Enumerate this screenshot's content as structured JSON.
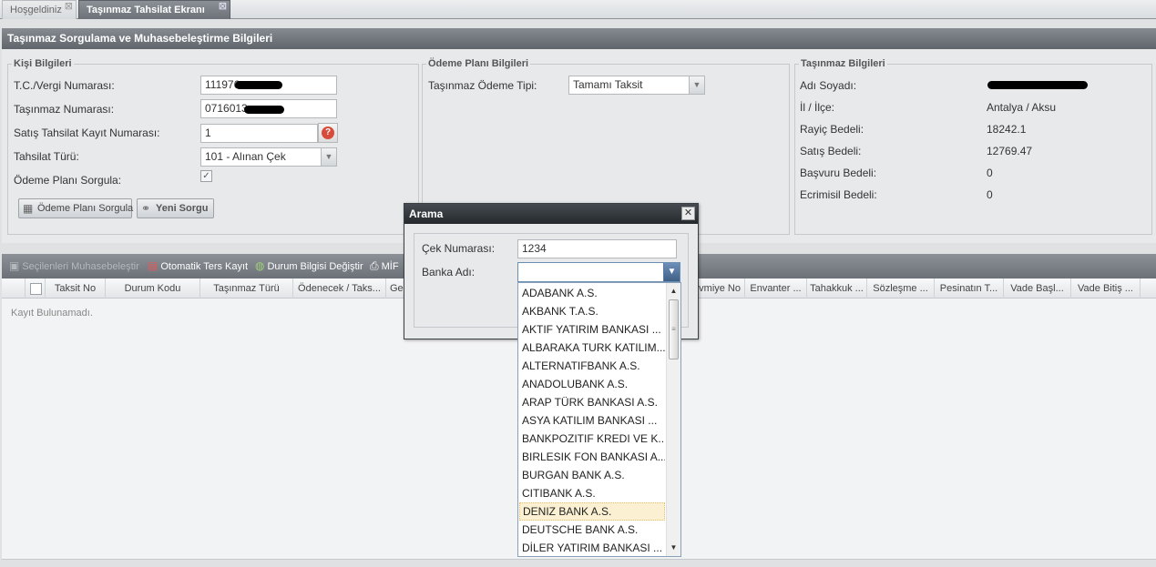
{
  "tabs": [
    {
      "label": "Hoşgeldiniz"
    },
    {
      "label": "Taşınmaz Tahsilat Ekranı"
    }
  ],
  "panel": {
    "title": "Taşınmaz Sorgulama ve Muhasebeleştirme Bilgileri"
  },
  "kisi": {
    "legend": "Kişi Bilgileri",
    "tc_label": "T.C./Vergi Numarası:",
    "tc_value": "111976",
    "tasinmaz_label": "Taşınmaz Numarası:",
    "tasinmaz_value": "0716013",
    "satis_label": "Satış Tahsilat Kayıt Numarası:",
    "satis_value": "1",
    "tahsilat_label": "Tahsilat Türü:",
    "tahsilat_value": "101 - Alınan Çek",
    "odeme_label": "Ödeme Planı Sorgula:",
    "odeme_checked": "✓",
    "sorgula_button": "Ödeme Planı Sorgula",
    "yeni_button": "Yeni Sorgu"
  },
  "odeme": {
    "legend": "Ödeme Planı Bilgileri",
    "tip_label": "Taşınmaz Ödeme Tipi:",
    "tip_value": "Tamamı Taksit"
  },
  "tasinmaz": {
    "legend": "Taşınmaz Bilgileri",
    "rows": [
      {
        "label": "Adı Soyadı:",
        "value": ""
      },
      {
        "label": "İl / İlçe:",
        "value": "Antalya / Aksu"
      },
      {
        "label": "Rayiç Bedeli:",
        "value": "18242.1"
      },
      {
        "label": "Satış Bedeli:",
        "value": "12769.47"
      },
      {
        "label": "Başvuru Bedeli:",
        "value": "0"
      },
      {
        "label": "Ecrimisil Bedeli:",
        "value": "0"
      }
    ]
  },
  "toolbar": {
    "muhasebe": "Seçilenleri Muhasebeleştir",
    "ters_kayit": "Otomatik Ters Kayıt",
    "durum": "Durum Bilgisi Değiştir",
    "mif": "MİF"
  },
  "grid": {
    "columns": [
      "Taksit No",
      "Durum Kodu",
      "Taşınmaz Türü",
      "Ödenecek / Taks...",
      "Ge",
      "vmiye No",
      "Envanter ...",
      "Tahakkuk ...",
      "Sözleşme ...",
      "Pesinatın T...",
      "Vade Başl...",
      "Vade Bitiş ..."
    ],
    "empty": "Kayıt Bulunamadı."
  },
  "modal": {
    "title": "Arama",
    "close": "✕",
    "cek_label": "Çek Numarası:",
    "cek_value": "1234",
    "banka_label": "Banka Adı:",
    "banka_value": ""
  },
  "banks": [
    "ADABANK A.S.",
    "AKBANK T.A.S.",
    "AKTIF YATIRIM BANKASI ...",
    "ALBARAKA TURK KATILIM...",
    "ALTERNATIFBANK A.S.",
    "ANADOLUBANK A.S.",
    "ARAP TÜRK BANKASI A.S.",
    "ASYA KATILIM BANKASI ...",
    "BANKPOZITIF KREDI VE K...",
    "BIRLESIK FON BANKASI A....",
    "BURGAN BANK A.S.",
    "CITIBANK A.S.",
    "DENIZ BANK A.S.",
    "DEUTSCHE BANK A.S.",
    "DİLER YATIRIM BANKASI ..."
  ],
  "selected_bank_index": 12,
  "icons": {
    "tab_close": "⊠",
    "combo": "▼",
    "help": "?",
    "scroll_up": "▲",
    "scroll_down": "▼",
    "grip": "≡"
  }
}
